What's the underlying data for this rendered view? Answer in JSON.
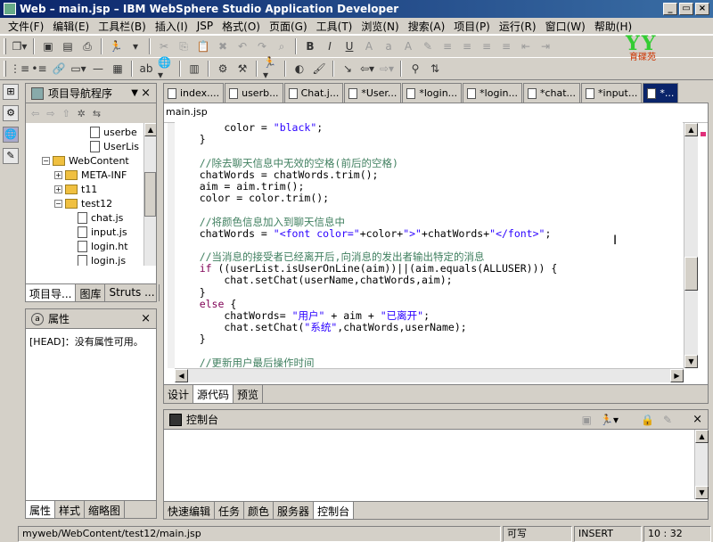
{
  "window": {
    "title": "Web – main.jsp – IBM WebSphere Studio Application Developer",
    "controls": [
      "_",
      "▭",
      "×"
    ]
  },
  "menu": [
    "文件(F)",
    "编辑(E)",
    "工具栏(B)",
    "插入(I)",
    "JSP",
    "格式(O)",
    "页面(G)",
    "工具(T)",
    "浏览(N)",
    "搜索(A)",
    "项目(P)",
    "运行(R)",
    "窗口(W)",
    "帮助(H)"
  ],
  "logo": {
    "big": "YY",
    "small": "育碟苑"
  },
  "navigator": {
    "title": "项目导航程序",
    "tree": [
      {
        "label": "userbe",
        "level": 4,
        "kind": "file"
      },
      {
        "label": "UserLis",
        "level": 4,
        "kind": "file"
      },
      {
        "label": "WebContent",
        "level": 1,
        "kind": "folder",
        "toggle": "−"
      },
      {
        "label": "META-INF",
        "level": 2,
        "kind": "folder",
        "toggle": "+"
      },
      {
        "label": "t11",
        "level": 2,
        "kind": "folder",
        "toggle": "+"
      },
      {
        "label": "test12",
        "level": 2,
        "kind": "folder",
        "toggle": "−"
      },
      {
        "label": "chat.js",
        "level": 3,
        "kind": "file"
      },
      {
        "label": "input.js",
        "level": 3,
        "kind": "file"
      },
      {
        "label": "login.ht",
        "level": 3,
        "kind": "file"
      },
      {
        "label": "login.js",
        "level": 3,
        "kind": "file"
      }
    ],
    "tabs": [
      "项目导...",
      "图库",
      "Struts ..."
    ]
  },
  "properties": {
    "title": "属性",
    "message": "[HEAD]：没有属性可用。",
    "tabs": [
      "属性",
      "样式",
      "缩略图"
    ]
  },
  "editor": {
    "tabs": [
      "index....",
      "userb...",
      "Chat.j...",
      "*User...",
      "*login...",
      "*login...",
      "*chat...",
      "*input...",
      "*..."
    ],
    "active_tab": 8,
    "file_label": "main.jsp",
    "code": [
      [
        {
          "t": "        color = "
        },
        {
          "t": "\"black\"",
          "c": "st"
        },
        {
          "t": ";"
        }
      ],
      [
        {
          "t": "    }"
        }
      ],
      [
        {
          "t": ""
        }
      ],
      [
        {
          "t": "    //除去聊天信息中无效的空格(前后的空格)",
          "c": "cm"
        }
      ],
      [
        {
          "t": "    chatWords = chatWords.trim();"
        }
      ],
      [
        {
          "t": "    aim = aim.trim();"
        }
      ],
      [
        {
          "t": "    color = color.trim();"
        }
      ],
      [
        {
          "t": ""
        }
      ],
      [
        {
          "t": "    //将颜色信息加入到聊天信息中",
          "c": "cm"
        }
      ],
      [
        {
          "t": "    chatWords = "
        },
        {
          "t": "\"<font color=\"",
          "c": "st"
        },
        {
          "t": "+color+"
        },
        {
          "t": "\">\"",
          "c": "st"
        },
        {
          "t": "+chatWords+"
        },
        {
          "t": "\"</font>\"",
          "c": "st"
        },
        {
          "t": ";"
        }
      ],
      [
        {
          "t": ""
        }
      ],
      [
        {
          "t": "    //当消息的接受者已经离开后,向消息的发出者输出特定的消息",
          "c": "cm"
        }
      ],
      [
        {
          "t": "    "
        },
        {
          "t": "if",
          "c": "kw"
        },
        {
          "t": " ((userList.isUserOnLine(aim))||(aim.equals(ALLUSER))) {"
        }
      ],
      [
        {
          "t": "        chat.setChat(userName,chatWords,aim);"
        }
      ],
      [
        {
          "t": "    }"
        }
      ],
      [
        {
          "t": "    "
        },
        {
          "t": "else",
          "c": "kw"
        },
        {
          "t": " {"
        }
      ],
      [
        {
          "t": "        chatWords= "
        },
        {
          "t": "\"用户\"",
          "c": "st"
        },
        {
          "t": " + aim + "
        },
        {
          "t": "\"已离开\"",
          "c": "st"
        },
        {
          "t": ";"
        }
      ],
      [
        {
          "t": "        chat.setChat("
        },
        {
          "t": "\"系统\"",
          "c": "st"
        },
        {
          "t": ",chatWords,userName);"
        }
      ],
      [
        {
          "t": "    }"
        }
      ],
      [
        {
          "t": ""
        }
      ],
      [
        {
          "t": "    //更新用户最后操作时间",
          "c": "cm"
        }
      ]
    ],
    "bottom_tabs": [
      "设计",
      "源代码",
      "预览"
    ],
    "active_bottom_tab": 1
  },
  "console": {
    "title": "控制台",
    "tabs": [
      "快速编辑",
      "任务",
      "颜色",
      "服务器",
      "控制台"
    ],
    "active_tab": 4
  },
  "status": {
    "path": "myweb/WebContent/test12/main.jsp",
    "writable": "可写",
    "mode": "INSERT",
    "position": "10 : 32"
  },
  "colors": {
    "title_bar": "#0a246a",
    "chrome": "#d4d0c8",
    "comment": "#3f7f5f",
    "string": "#2a00ff",
    "keyword": "#7f0055"
  }
}
